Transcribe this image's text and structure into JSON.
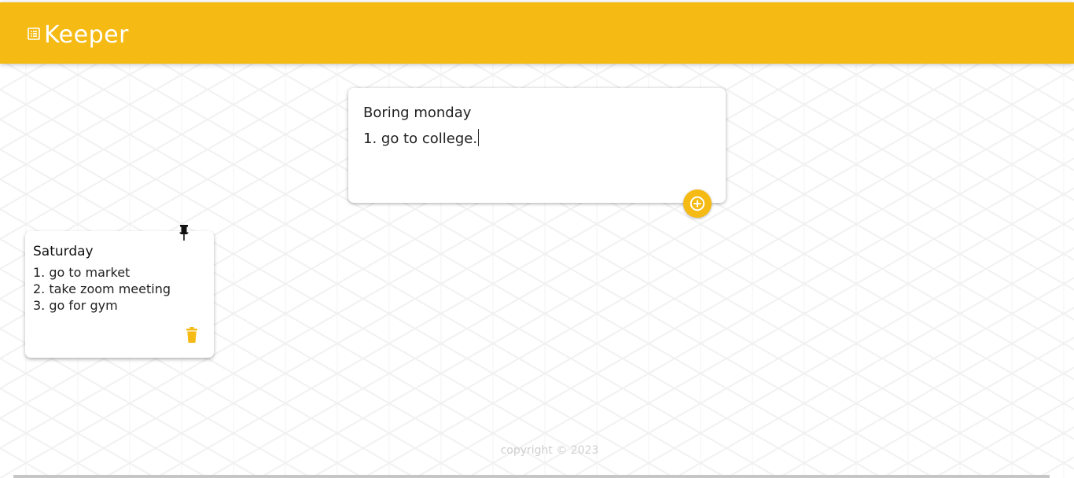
{
  "app": {
    "title": "Keeper",
    "icon": "note-list-icon",
    "accent_color": "#f5ba13"
  },
  "create_area": {
    "title_value": "Boring monday",
    "content_value": "1. go to college.",
    "add_button_icon": "add-circle-icon"
  },
  "notes": [
    {
      "title": "Saturday",
      "lines": [
        "1. go to market",
        "2. take zoom meeting",
        "3. go for gym"
      ],
      "pin_icon": "pin-icon",
      "delete_icon": "trash-icon"
    }
  ],
  "footer": {
    "text": "copyright © 2023"
  }
}
